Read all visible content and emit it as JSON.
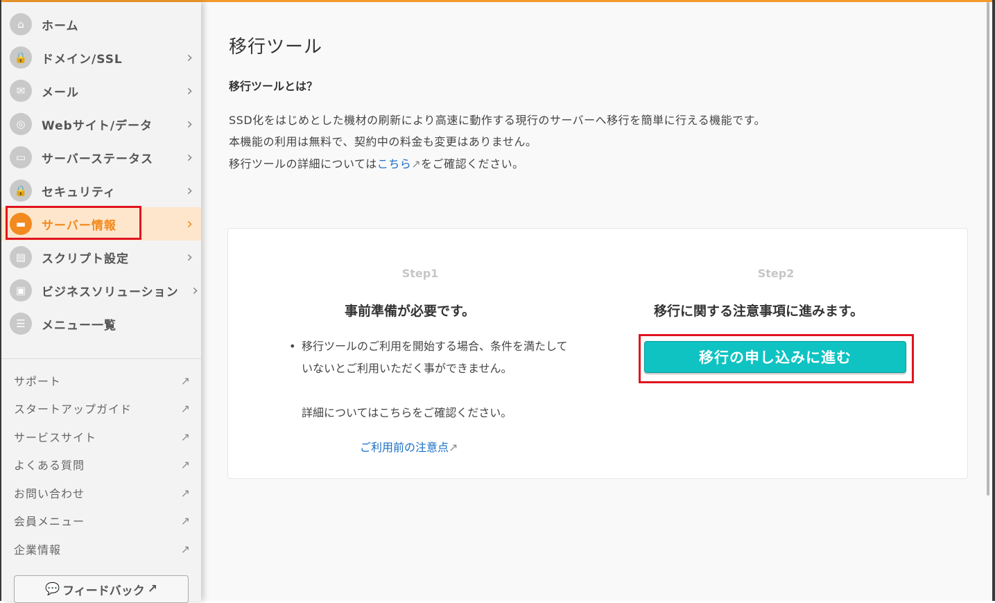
{
  "sidebar": {
    "items": [
      {
        "label": "ホーム",
        "icon": "home-icon",
        "chevron": false
      },
      {
        "label": "ドメイン/SSL",
        "icon": "domain-icon",
        "chevron": true
      },
      {
        "label": "メール",
        "icon": "mail-icon",
        "chevron": true
      },
      {
        "label": "Webサイト/データ",
        "icon": "globe-icon",
        "chevron": true
      },
      {
        "label": "サーバーステータス",
        "icon": "chart-icon",
        "chevron": true
      },
      {
        "label": "セキュリティ",
        "icon": "lock-icon",
        "chevron": true
      },
      {
        "label": "サーバー情報",
        "icon": "server-icon",
        "chevron": true,
        "active": true
      },
      {
        "label": "スクリプト設定",
        "icon": "script-icon",
        "chevron": true
      },
      {
        "label": "ビジネスソリューション",
        "icon": "briefcase-icon",
        "chevron": true
      },
      {
        "label": "メニュー一覧",
        "icon": "list-icon",
        "chevron": false
      }
    ],
    "links": [
      {
        "label": "サポート"
      },
      {
        "label": "スタートアップガイド"
      },
      {
        "label": "サービスサイト"
      },
      {
        "label": "よくある質問"
      },
      {
        "label": "お問い合わせ"
      },
      {
        "label": "会員メニュー"
      },
      {
        "label": "企業情報"
      }
    ],
    "feedback_label": "フィードバック"
  },
  "main": {
    "title": "移行ツール",
    "section_heading": "移行ツールとは？",
    "desc_line1": "SSD化をはじめとした機材の刷新により高速に動作する現行のサーバーへ移行を簡単に行える機能です。",
    "desc_line2": "本機能の利用は無料で、契約中の料金も変更はありません。",
    "desc_line3_pre": "移行ツールの詳細については",
    "desc_line3_link": "こちら",
    "desc_line3_post": "をご確認ください。",
    "step1": {
      "label": "Step1",
      "title": "事前準備が必要です。",
      "bullet": "移行ツールのご利用を開始する場合、条件を満たしていないとご利用いただく事ができません。",
      "sub": "詳細についてはこちらをご確認ください。",
      "link": "ご利用前の注意点"
    },
    "step2": {
      "label": "Step2",
      "title": "移行に関する注意事項に進みます。",
      "button": "移行の申し込みに進む"
    }
  },
  "colors": {
    "accent": "#f28a1f",
    "active_bg": "#fde6cc",
    "button": "#0fc3c3",
    "link": "#1a6fc4",
    "highlight": "#e0141e"
  }
}
